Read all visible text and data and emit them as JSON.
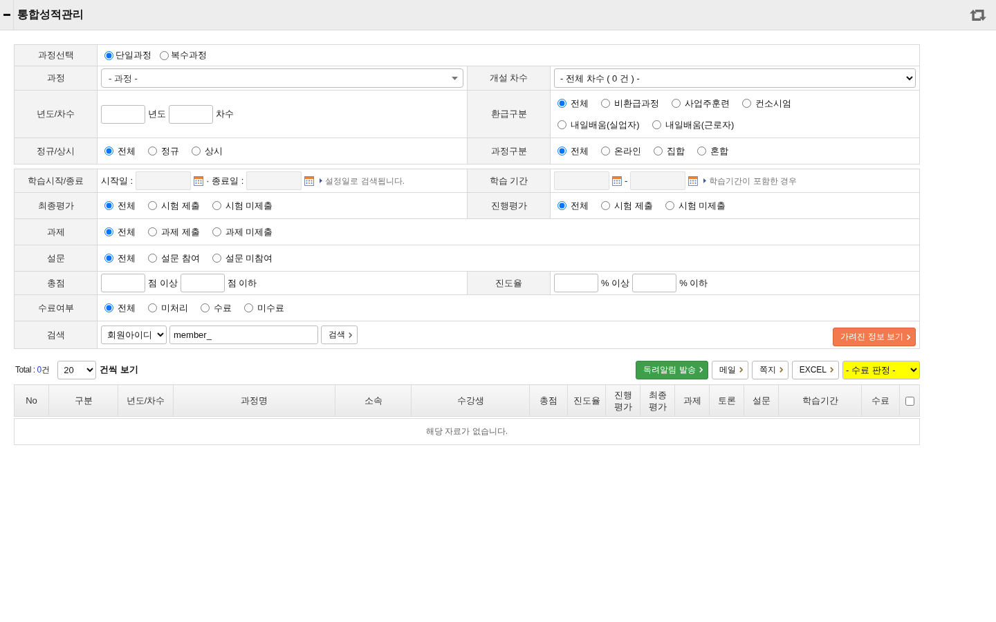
{
  "panel": {
    "title": "통합성적관리"
  },
  "filters": [
    {
      "rows": [
        {
          "fields": [
            {
              "label": "과정선택",
              "lines": [
                [
                  {
                    "kind": "radio_compact",
                    "options": [
                      {
                        "label": "단일과정",
                        "selected": true
                      },
                      {
                        "label": "복수과정",
                        "selected": false
                      }
                    ]
                  }
                ]
              ]
            }
          ]
        },
        {
          "fields": [
            {
              "label": "과정",
              "lines": [
                [
                  {
                    "kind": "custom_select",
                    "value": "- 과정 -"
                  }
                ]
              ]
            },
            {
              "label": "개설 차수",
              "lines": [
                [
                  {
                    "kind": "select",
                    "value": "- 전체 차수 ( 0 건 ) -"
                  }
                ]
              ]
            }
          ]
        },
        {
          "fields": [
            {
              "label": "년도/차수",
              "lines": [
                [
                  {
                    "kind": "input"
                  },
                  {
                    "kind": "text",
                    "text": "년도"
                  },
                  {
                    "kind": "input"
                  },
                  {
                    "kind": "text",
                    "text": "차수"
                  }
                ]
              ]
            },
            {
              "label": "환급구분",
              "lines": [
                [
                  {
                    "kind": "radio",
                    "options": [
                      {
                        "label": "전체",
                        "selected": true
                      },
                      {
                        "label": "비환급과정",
                        "selected": false
                      },
                      {
                        "label": "사업주훈련",
                        "selected": false
                      },
                      {
                        "label": "컨소시엄",
                        "selected": false
                      }
                    ]
                  }
                ],
                [
                  {
                    "kind": "radio",
                    "options": [
                      {
                        "label": "내일배움(실업자)",
                        "selected": false
                      },
                      {
                        "label": "내일배움(근로자)",
                        "selected": false
                      }
                    ]
                  }
                ]
              ]
            }
          ]
        },
        {
          "fields": [
            {
              "label": "정규/상시",
              "lines": [
                [
                  {
                    "kind": "radio",
                    "options": [
                      {
                        "label": "전체",
                        "selected": true
                      },
                      {
                        "label": "정규",
                        "selected": false
                      },
                      {
                        "label": "상시",
                        "selected": false
                      }
                    ]
                  }
                ]
              ]
            },
            {
              "label": "과정구분",
              "lines": [
                [
                  {
                    "kind": "radio",
                    "options": [
                      {
                        "label": "전체",
                        "selected": true
                      },
                      {
                        "label": "온라인",
                        "selected": false
                      },
                      {
                        "label": "집합",
                        "selected": false
                      },
                      {
                        "label": "혼합",
                        "selected": false
                      }
                    ]
                  }
                ]
              ]
            }
          ]
        }
      ]
    },
    {
      "rows": [
        {
          "fields": [
            {
              "label": "학습시작/종료",
              "lines": [
                [
                  {
                    "kind": "text",
                    "text": "시작일 :"
                  },
                  {
                    "kind": "date"
                  },
                  {
                    "kind": "text",
                    "text": "· 종료일 :"
                  },
                  {
                    "kind": "date"
                  },
                  {
                    "kind": "note",
                    "text": "설정일로 검색됩니다."
                  }
                ]
              ]
            },
            {
              "label": "학습 기간",
              "lines": [
                [
                  {
                    "kind": "date"
                  },
                  {
                    "kind": "text",
                    "text": "-"
                  },
                  {
                    "kind": "date"
                  },
                  {
                    "kind": "note",
                    "text": "학습기간이 포함한 경우"
                  }
                ]
              ]
            }
          ]
        },
        {
          "fields": [
            {
              "label": "최종평가",
              "lines": [
                [
                  {
                    "kind": "radio",
                    "options": [
                      {
                        "label": "전체",
                        "selected": true
                      },
                      {
                        "label": "시험 제출",
                        "selected": false
                      },
                      {
                        "label": "시험 미제출",
                        "selected": false
                      }
                    ]
                  }
                ]
              ]
            },
            {
              "label": "진행평가",
              "lines": [
                [
                  {
                    "kind": "radio",
                    "options": [
                      {
                        "label": "전체",
                        "selected": true
                      },
                      {
                        "label": "시험 제출",
                        "selected": false
                      },
                      {
                        "label": "시험 미제출",
                        "selected": false
                      }
                    ]
                  }
                ]
              ]
            }
          ]
        },
        {
          "fields": [
            {
              "label": "과제",
              "lines": [
                [
                  {
                    "kind": "radio",
                    "options": [
                      {
                        "label": "전체",
                        "selected": true
                      },
                      {
                        "label": "과제 제출",
                        "selected": false
                      },
                      {
                        "label": "과제 미제출",
                        "selected": false
                      }
                    ]
                  }
                ]
              ]
            }
          ]
        },
        {
          "fields": [
            {
              "label": "설문",
              "lines": [
                [
                  {
                    "kind": "radio",
                    "options": [
                      {
                        "label": "전체",
                        "selected": true
                      },
                      {
                        "label": "설문 참여",
                        "selected": false
                      },
                      {
                        "label": "설문 미참여",
                        "selected": false
                      }
                    ]
                  }
                ]
              ]
            }
          ]
        },
        {
          "fields": [
            {
              "label": "총점",
              "lines": [
                [
                  {
                    "kind": "input"
                  },
                  {
                    "kind": "text",
                    "text": "점 이상"
                  },
                  {
                    "kind": "input"
                  },
                  {
                    "kind": "text",
                    "text": "점 이하"
                  }
                ]
              ]
            },
            {
              "label": "진도율",
              "lines": [
                [
                  {
                    "kind": "input"
                  },
                  {
                    "kind": "text",
                    "text": "% 이상"
                  },
                  {
                    "kind": "input"
                  },
                  {
                    "kind": "text",
                    "text": "% 이하"
                  }
                ]
              ]
            }
          ]
        },
        {
          "fields": [
            {
              "label": "수료여부",
              "lines": [
                [
                  {
                    "kind": "radio",
                    "options": [
                      {
                        "label": "전체",
                        "selected": true
                      },
                      {
                        "label": "미처리",
                        "selected": false
                      },
                      {
                        "label": "수료",
                        "selected": false
                      },
                      {
                        "label": "미수료",
                        "selected": false
                      }
                    ]
                  }
                ]
              ]
            }
          ]
        },
        {
          "fields": [
            {
              "label": "검색",
              "lines": [
                [
                  {
                    "kind": "select",
                    "value": "회원아이디"
                  },
                  {
                    "kind": "search_input",
                    "value": "member_"
                  },
                  {
                    "kind": "button",
                    "label": "검색"
                  },
                  {
                    "kind": "reveal_button",
                    "label": "가려진 정보 보기"
                  }
                ]
              ]
            }
          ]
        }
      ]
    }
  ],
  "list_toolbar": {
    "total_label": "Total :",
    "total_count": "0",
    "total_unit": "건",
    "page_size": "20",
    "page_size_label": "건씩 보기",
    "buttons": [
      {
        "kind": "send",
        "label": "독려알림 발송"
      },
      {
        "kind": "plain",
        "label": "메일"
      },
      {
        "kind": "plain",
        "label": "쪽지"
      },
      {
        "kind": "plain",
        "label": "EXCEL"
      }
    ],
    "completion_select": "- 수료 판정 -"
  },
  "list_table": {
    "columns": [
      "No",
      "구분",
      "년도/차수",
      "과정명",
      "소속",
      "수강생",
      "총점",
      "진도율",
      "진행 평가",
      "최종 평가",
      "과제",
      "토론",
      "설문",
      "학습기간",
      "수료"
    ],
    "select_all": {
      "checked": false
    },
    "empty_message": "해당 자료가 없습니다."
  }
}
